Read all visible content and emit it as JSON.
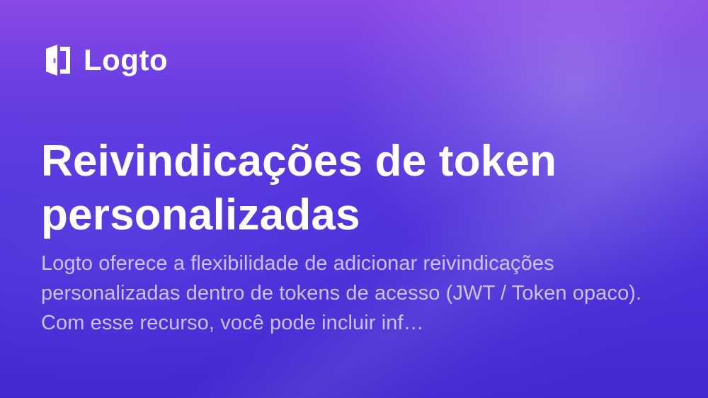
{
  "brand": {
    "name": "Logto",
    "icon": "logto-door-icon"
  },
  "content": {
    "title": "Reivindicações de token personalizadas",
    "description": "Logto oferece a flexibilidade de adicionar reivindicações personalizadas dentro de tokens de acesso (JWT / Token opaco). Com esse recurso, você pode incluir inf…"
  },
  "colors": {
    "background_top": "#8a48e6",
    "background_bottom": "#4328d0",
    "text_primary": "#ffffff",
    "text_secondary": "#e2dcff"
  }
}
